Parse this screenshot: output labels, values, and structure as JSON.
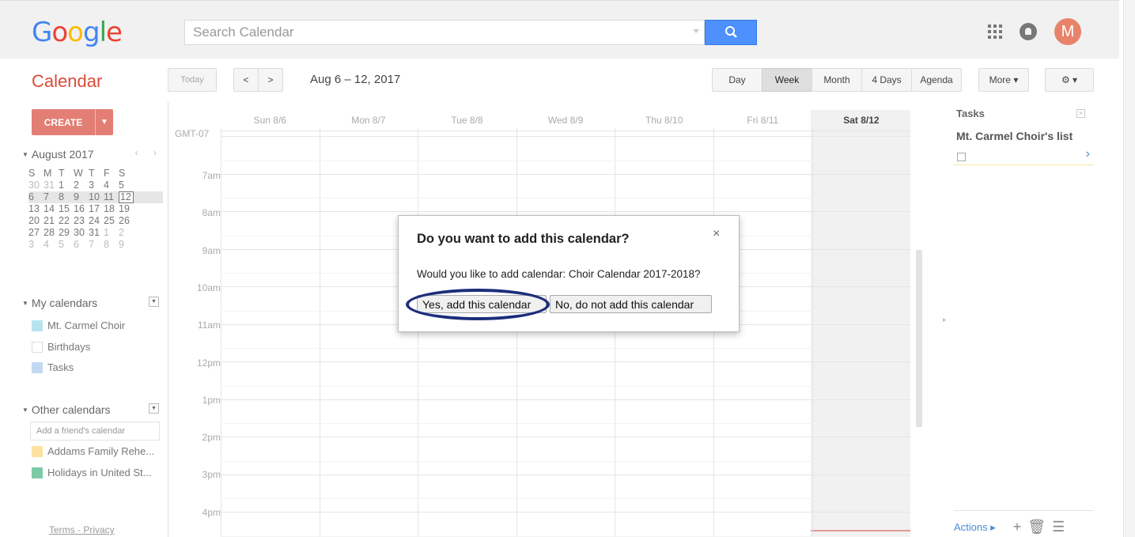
{
  "header": {
    "logo": "Google",
    "logo_colors": [
      "#4285f4",
      "#ea4335",
      "#fbbc05",
      "#4285f4",
      "#34a853",
      "#ea4335"
    ],
    "search_placeholder": "Search Calendar",
    "avatar_letter": "M"
  },
  "toolbar": {
    "app_title": "Calendar",
    "today_label": "Today",
    "prev_label": "<",
    "next_label": ">",
    "date_range": "Aug 6 – 12, 2017",
    "views": [
      "Day",
      "Week",
      "Month",
      "4 Days",
      "Agenda"
    ],
    "active_view": "Week",
    "more_label": "More ▾",
    "gear_label": "⚙ ▾"
  },
  "sidebar": {
    "create_label": "CREATE",
    "create_arrow": "▼",
    "mini_title": "August 2017",
    "mini_nav": "‹ ›",
    "weekdays": [
      "S",
      "M",
      "T",
      "W",
      "T",
      "F",
      "S"
    ],
    "weeks": [
      [
        "30",
        "31",
        "1",
        "2",
        "3",
        "4",
        "5"
      ],
      [
        "6",
        "7",
        "8",
        "9",
        "10",
        "11",
        "12"
      ],
      [
        "13",
        "14",
        "15",
        "16",
        "17",
        "18",
        "19"
      ],
      [
        "20",
        "21",
        "22",
        "23",
        "24",
        "25",
        "26"
      ],
      [
        "27",
        "28",
        "29",
        "30",
        "31",
        "1",
        "2"
      ],
      [
        "3",
        "4",
        "5",
        "6",
        "7",
        "8",
        "9"
      ]
    ],
    "my_calendars_label": "My calendars",
    "my_calendars": [
      {
        "name": "Mt. Carmel Choir",
        "color": "#b7e3ee"
      },
      {
        "name": "Birthdays",
        "color": "#ffffff"
      },
      {
        "name": "Tasks",
        "color": "#c3d9f2"
      }
    ],
    "other_calendars_label": "Other calendars",
    "friend_placeholder": "Add a friend's calendar",
    "other_calendars": [
      {
        "name": "Addams Family Rehe...",
        "color": "#fde29f"
      },
      {
        "name": "Holidays in United St...",
        "color": "#7dcba6"
      }
    ],
    "terms": "Terms",
    "privacy": "Privacy"
  },
  "grid": {
    "timezone": "GMT-07",
    "days": [
      "Sun 8/6",
      "Mon 8/7",
      "Tue 8/8",
      "Wed 8/9",
      "Thu 8/10",
      "Fri 8/11",
      "Sat 8/12"
    ],
    "selected_day": "Sat 8/12",
    "hours": [
      "7am",
      "8am",
      "9am",
      "10am",
      "11am",
      "12pm",
      "1pm",
      "2pm",
      "3pm",
      "4pm"
    ]
  },
  "tasks": {
    "title": "Tasks",
    "list_name": "Mt. Carmel Choir's list",
    "actions_label": "Actions ▸"
  },
  "dialog": {
    "title": "Do you want to add this calendar?",
    "close": "×",
    "message": "Would you like to add calendar: Choir Calendar 2017-2018?",
    "yes_label": "Yes, add this calendar",
    "no_label": "No, do not add this calendar"
  }
}
